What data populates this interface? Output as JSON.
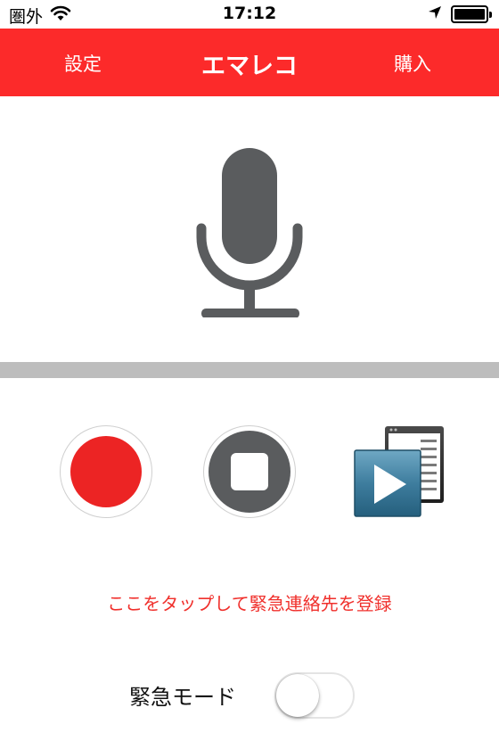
{
  "status_bar": {
    "carrier": "圏外",
    "time": "17:12",
    "battery_level": 1.0
  },
  "navbar": {
    "left_label": "設定",
    "title": "エマレコ",
    "right_label": "購入",
    "color": "#fc2a2a"
  },
  "icons": {
    "microphone": "microphone-icon",
    "record": "record-icon",
    "stop": "stop-icon",
    "playback": "video-playback-icon"
  },
  "emergency": {
    "link_text": "ここをタップして緊急連絡先を登録",
    "color": "#f0302c"
  },
  "mode": {
    "label": "緊急モード",
    "enabled": false
  }
}
